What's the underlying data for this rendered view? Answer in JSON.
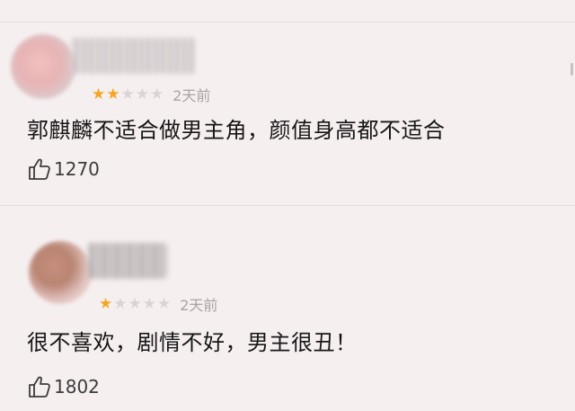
{
  "reviews": [
    {
      "stars_filled": 2,
      "stars_total": 5,
      "time": "2天前",
      "comment": "郭麒麟不适合做男主角，颜值身高都不适合",
      "likes": "1270"
    },
    {
      "stars_filled": 1,
      "stars_total": 5,
      "time": "2天前",
      "comment": "很不喜欢，剧情不好，男主很丑！",
      "likes": "1802"
    }
  ],
  "colors": {
    "background": "#f6eff0",
    "star_on": "#f5a623",
    "star_off": "#d9d5d6",
    "muted_text": "#a8a3a5"
  }
}
